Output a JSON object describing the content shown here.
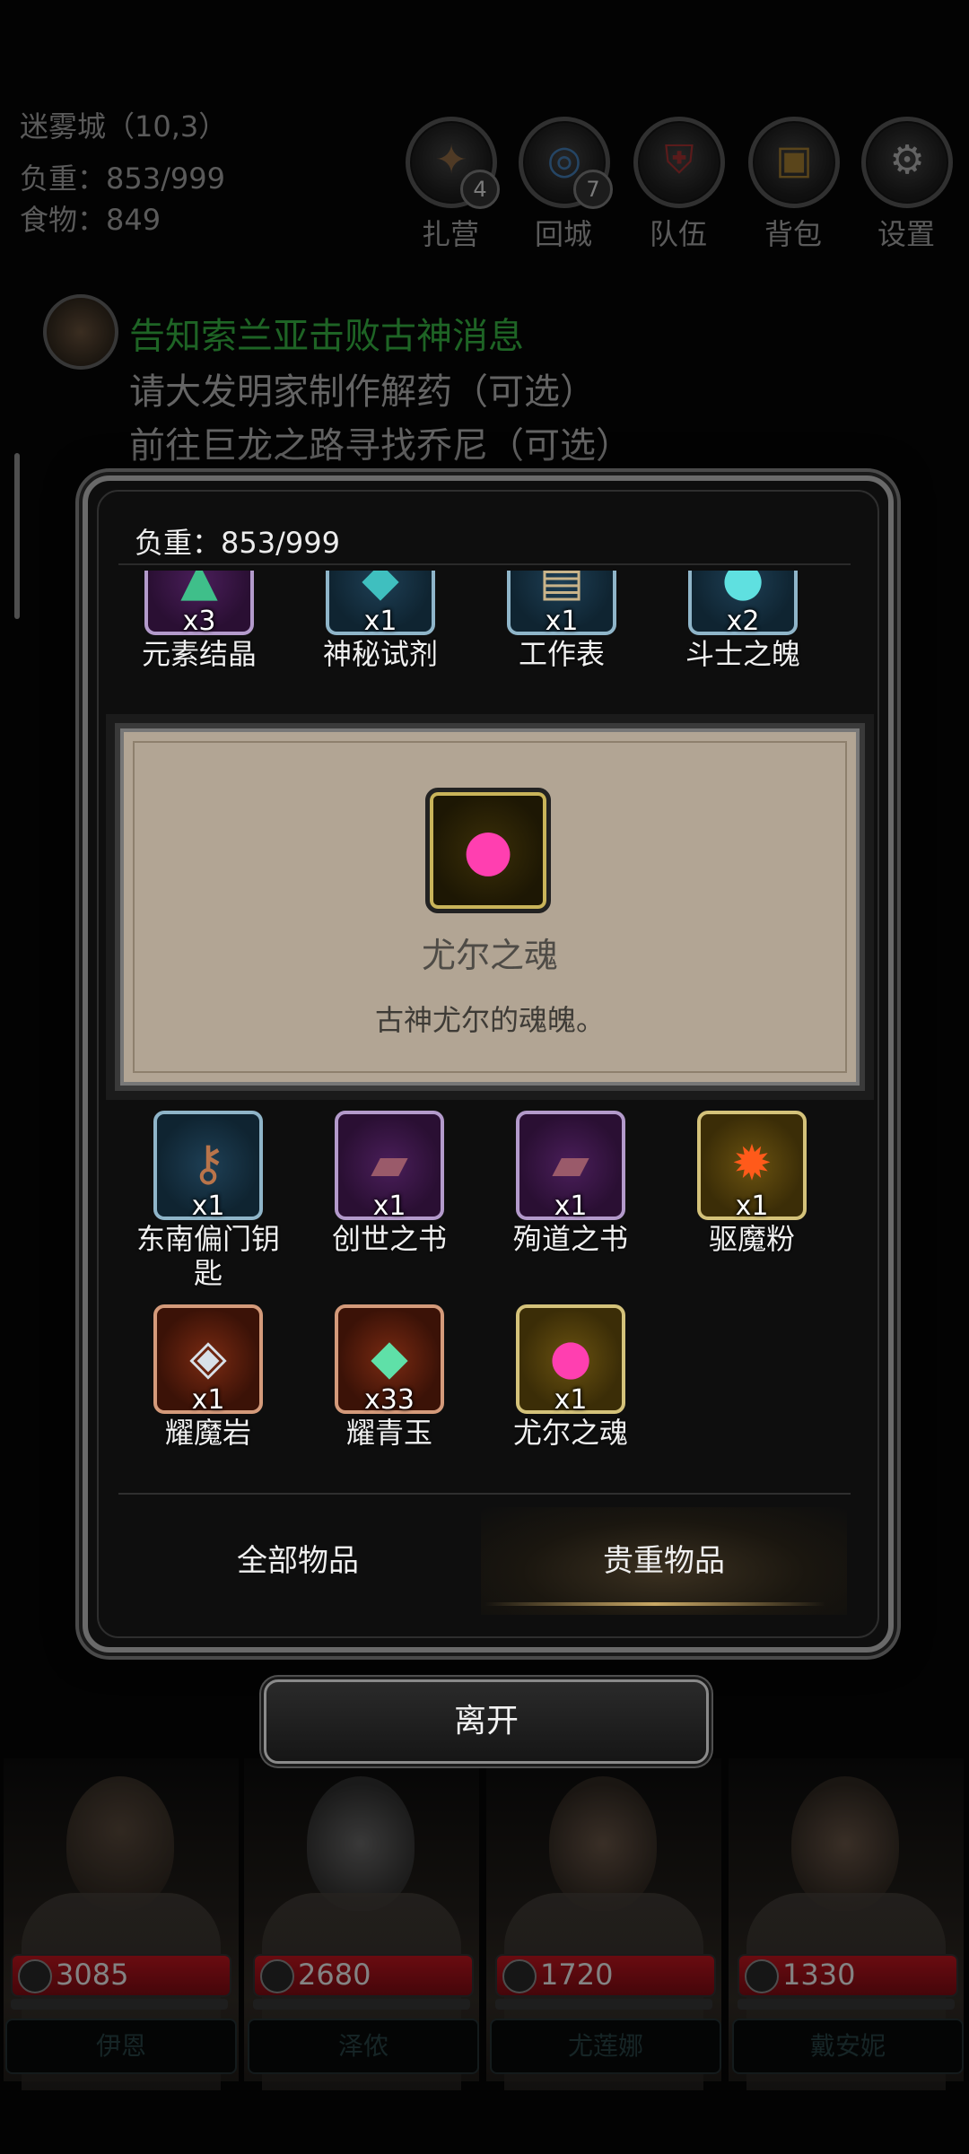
{
  "hud": {
    "location": "迷雾城（10,3）",
    "weight": "负重：853/999",
    "food": "食物：849"
  },
  "top_buttons": [
    {
      "label": "扎营",
      "badge": "4",
      "icon": "campfire-icon"
    },
    {
      "label": "回城",
      "badge": "7",
      "icon": "portal-icon"
    },
    {
      "label": "队伍",
      "badge": "",
      "icon": "party-shield-icon"
    },
    {
      "label": "背包",
      "badge": "",
      "icon": "backpack-icon"
    },
    {
      "label": "设置",
      "badge": "",
      "icon": "gear-icon"
    }
  ],
  "quests": [
    {
      "text": "告知索兰亚击败古神消息",
      "color": "#2f9a3a"
    },
    {
      "text": "请大发明家制作解药（可选）",
      "color": "#9a9a9a"
    },
    {
      "text": "前往巨龙之路寻找乔尼（可选）",
      "color": "#9a9a9a"
    }
  ],
  "inventory": {
    "weight": "负重：853/999",
    "top_row": [
      {
        "name": "元素结晶",
        "count": "x3",
        "quality": "purple",
        "icon": "crystal-icon"
      },
      {
        "name": "神秘试剂",
        "count": "x1",
        "quality": "blue",
        "icon": "potion-icon"
      },
      {
        "name": "工作表",
        "count": "x1",
        "quality": "blue",
        "icon": "scroll-icon"
      },
      {
        "name": "斗士之魄",
        "count": "x2",
        "quality": "blue",
        "icon": "soul-orb-icon"
      }
    ],
    "rows": [
      [
        {
          "name": "东南偏门钥匙",
          "count": "x1",
          "quality": "blue",
          "icon": "key-icon"
        },
        {
          "name": "创世之书",
          "count": "x1",
          "quality": "purple",
          "icon": "book-icon"
        },
        {
          "name": "殉道之书",
          "count": "x1",
          "quality": "purple",
          "icon": "book-icon"
        },
        {
          "name": "驱魔粉",
          "count": "x1",
          "quality": "gold",
          "icon": "powder-icon"
        }
      ],
      [
        {
          "name": "耀魔岩",
          "count": "x1",
          "quality": "red",
          "icon": "ore-icon"
        },
        {
          "name": "耀青玉",
          "count": "x33",
          "quality": "red",
          "icon": "jade-icon"
        },
        {
          "name": "尤尔之魂",
          "count": "x1",
          "quality": "gold",
          "icon": "soul-orb-icon"
        }
      ]
    ],
    "detail": {
      "name": "尤尔之魂",
      "description": "古神尤尔的魂魄。",
      "icon": "soul-orb-icon"
    },
    "tabs": [
      {
        "label": "全部物品",
        "active": false
      },
      {
        "label": "贵重物品",
        "active": true
      }
    ]
  },
  "leave_button": "离开",
  "heroes": [
    {
      "hp": "3085",
      "name": "伊恩"
    },
    {
      "hp": "2680",
      "name": "泽侬"
    },
    {
      "hp": "1720",
      "name": "尤莲娜"
    },
    {
      "hp": "1330",
      "name": "戴安妮"
    }
  ],
  "colors": {
    "accent_gold": "#c9a865",
    "hp_red": "#a3121a",
    "quest_green": "#2f9a3a",
    "detail_bg": "#b2a594"
  }
}
